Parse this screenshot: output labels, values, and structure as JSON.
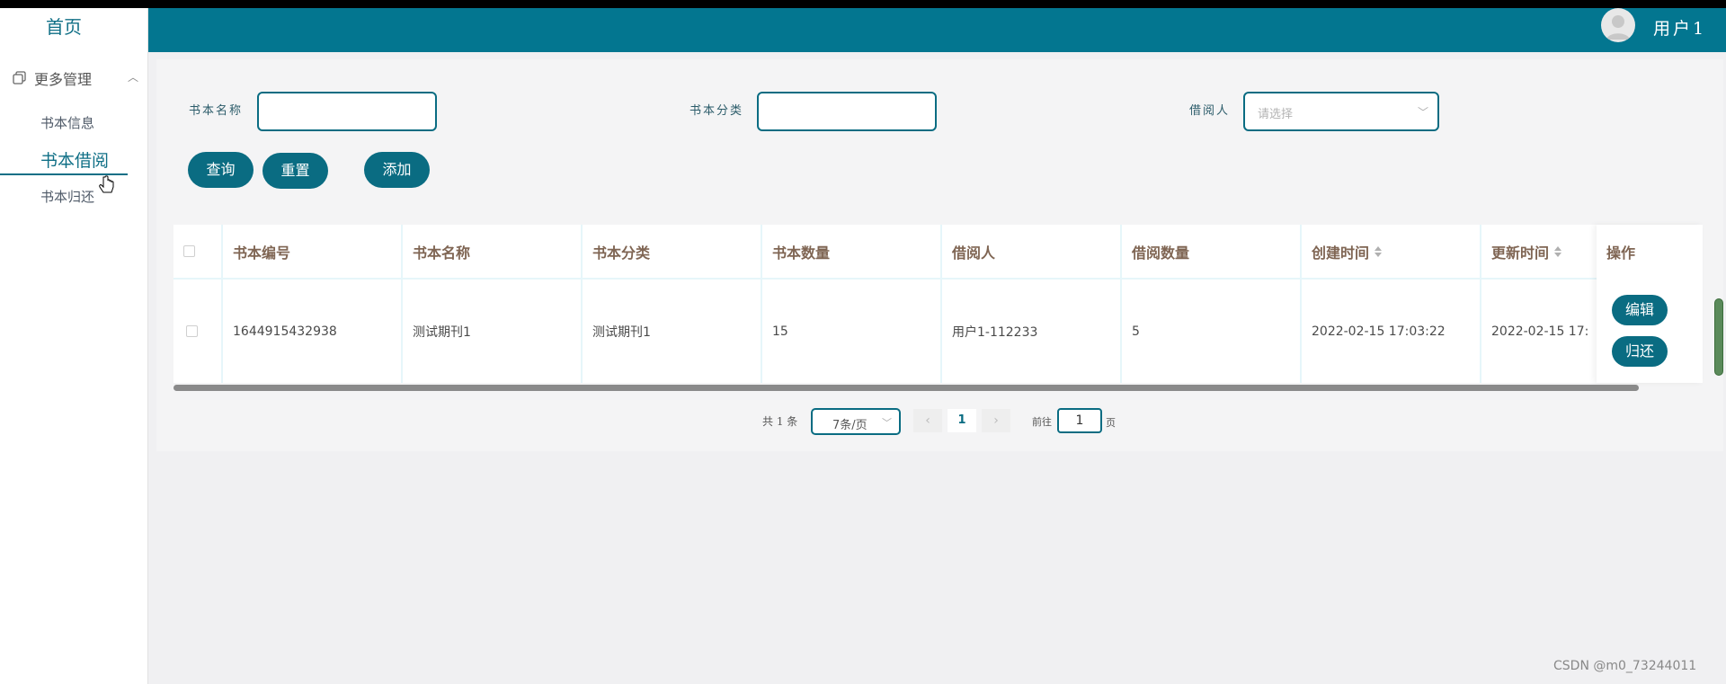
{
  "sidebar": {
    "home": "首页",
    "group_label": "更多管理",
    "items": [
      {
        "label": "书本信息"
      },
      {
        "label": "书本借阅"
      },
      {
        "label": "书本归还"
      }
    ]
  },
  "header": {
    "username": "用户1"
  },
  "filters": {
    "book_name_label": "书本名称",
    "book_name_value": "",
    "book_category_label": "书本分类",
    "book_category_value": "",
    "borrower_label": "借阅人",
    "borrower_placeholder": "请选择"
  },
  "buttons": {
    "query": "查询",
    "reset": "重置",
    "add": "添加"
  },
  "table": {
    "columns": [
      "书本编号",
      "书本名称",
      "书本分类",
      "书本数量",
      "借阅人",
      "借阅数量",
      "创建时间",
      "更新时间",
      "操作"
    ],
    "rows": [
      {
        "book_no": "1644915432938",
        "book_name": "测试期刊1",
        "book_category": "测试期刊1",
        "book_count": "15",
        "borrower": "用户1-112233",
        "borrow_count": "5",
        "created": "2022-02-15 17:03:22",
        "updated": "2022-02-15 17:",
        "edit": "编辑",
        "return": "归还"
      }
    ]
  },
  "pagination": {
    "total": "共 1 条",
    "page_size": "7条/页",
    "prev": "‹",
    "current": "1",
    "next": "›",
    "goto_label": "前往",
    "goto_value": "1",
    "page_suffix": "页"
  },
  "watermark": "CSDN @m0_73244011",
  "colors": {
    "primary": "#037690",
    "button": "#0a6c82",
    "header_text": "#7f6553"
  }
}
